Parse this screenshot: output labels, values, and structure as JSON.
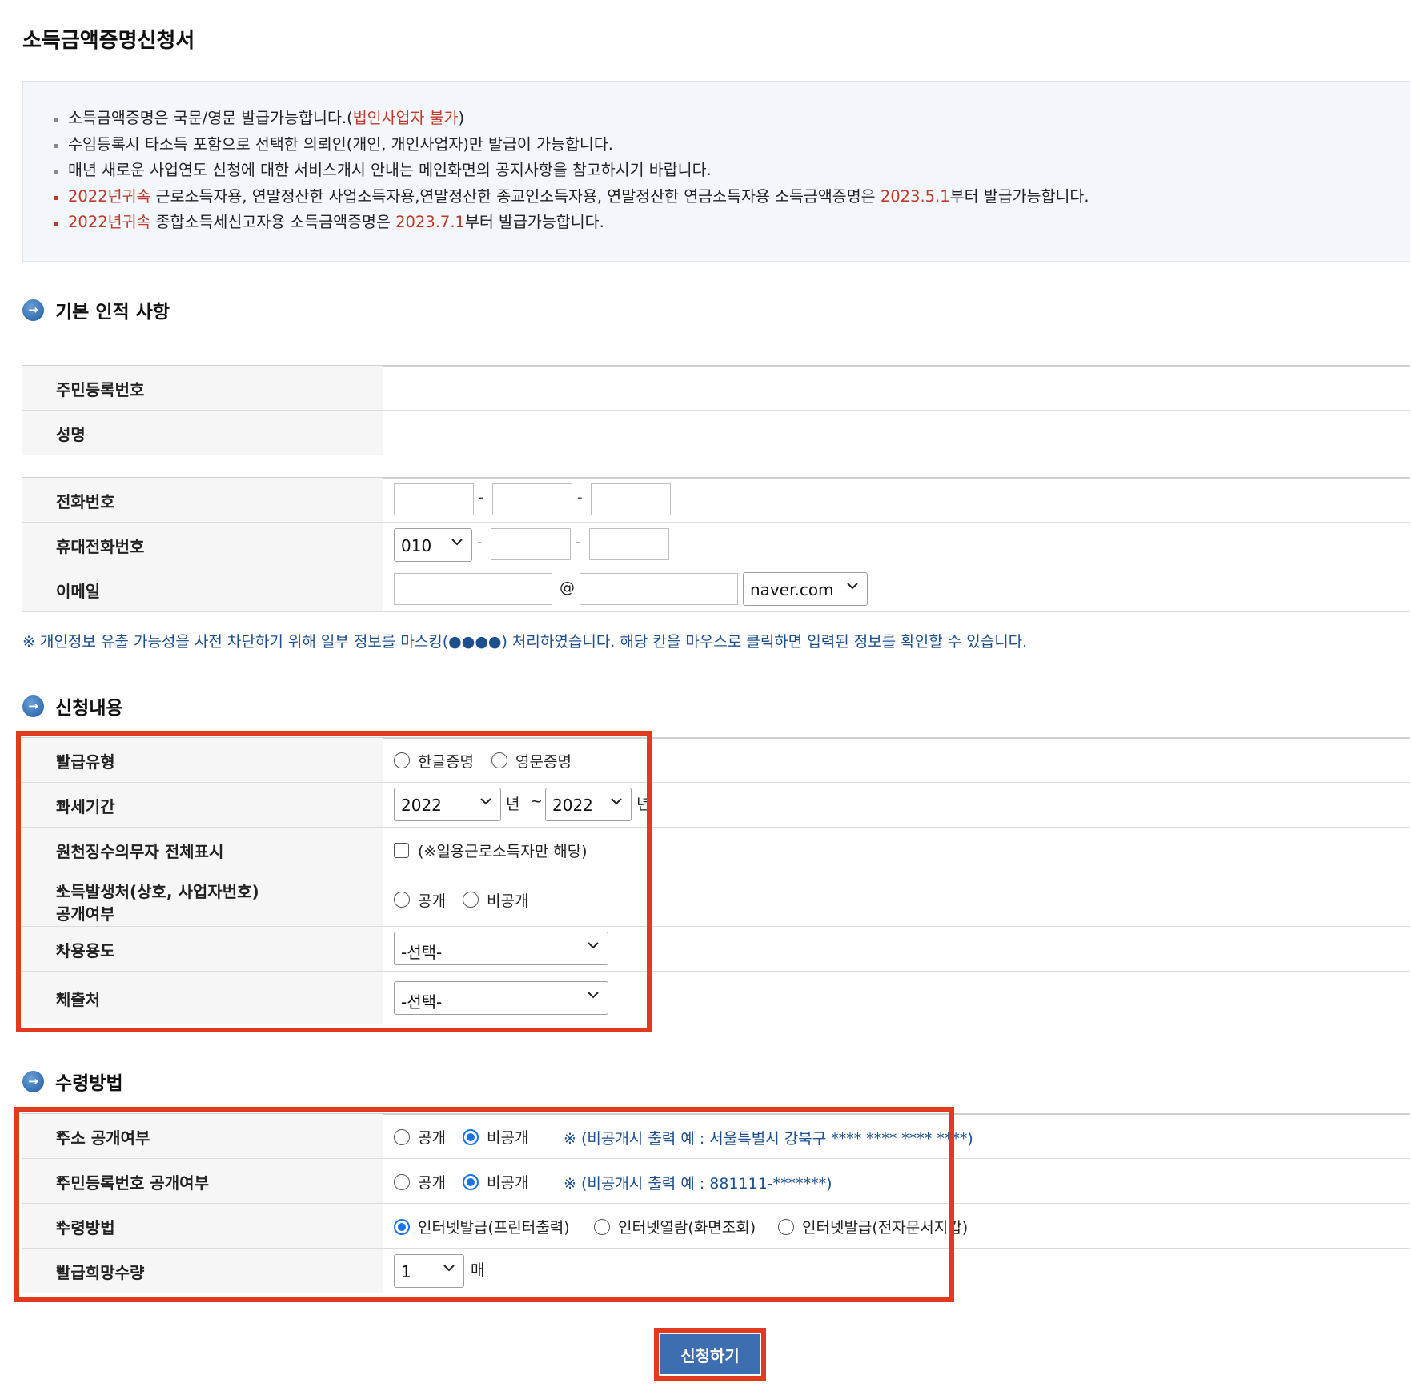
{
  "page": {
    "title": "소득금액증명신청서"
  },
  "notice": {
    "line1_a": "소득금액증명은 국문/영문 발급가능합니다.(",
    "line1_red": "법인사업자 불가",
    "line1_b": ")",
    "line2": "수임등록시 타소득 포함으로 선택한 의뢰인(개인, 개인사업자)만 발급이 가능합니다.",
    "line3": "매년 새로운 사업연도 신청에 대한 서비스개시 안내는 메인화면의 공지사항을 참고하시기 바랍니다.",
    "line4_red1": "2022년귀속",
    "line4_a": " 근로소득자용, 연말정산한 사업소득자용,연말정산한 종교인소득자용, 연말정산한 연금소득자용 소득금액증명은 ",
    "line4_red2": "2023.5.1",
    "line4_b": "부터 발급가능합니다.",
    "line5_red1": "2022년귀속",
    "line5_a": " 종합소득세신고자용 소득금액증명은 ",
    "line5_red2": "2023.7.1",
    "line5_b": "부터 발급가능합니다."
  },
  "basic": {
    "title": "기본 인적 사항",
    "resident_label": "주민등록번호",
    "name_label": "성명",
    "phone_label": "전화번호",
    "mobile_label": "휴대전화번호",
    "mobile_prefix": "010",
    "email_label": "이메일",
    "at": "@",
    "email_domain": "naver.com",
    "dash": "-",
    "mask_note": "※ 개인정보 유출 가능성을 사전 차단하기 위해 일부 정보를 마스킹(●●●●) 처리하였습니다. 해당 칸을 마우스로 클릭하면 입력된 정보를 확인할 수 있습니다."
  },
  "request": {
    "title": "신청내용",
    "req_mark": "*",
    "issue_type_label": "발급유형",
    "issue_korean": "한글증명",
    "issue_english": "영문증명",
    "period_label": "과세기간",
    "year_from": "2022",
    "year_unit": "년",
    "tilde": "~",
    "year_to": "2022",
    "withholding_label": "원천징수의무자 전체표시",
    "withholding_note": "(※일용근로소득자만 해당)",
    "source_label_1": "소득발생처(상호, 사업자번호)",
    "source_label_2": "공개여부",
    "public": "공개",
    "private": "비공개",
    "usage_label": "사용용도",
    "usage_value": "-선택-",
    "submit_to_label": "제출처",
    "submit_to_value": "-선택-"
  },
  "receive": {
    "title": "수령방법",
    "address_label": "주소 공개여부",
    "address_note": "※ (비공개시 출력 예 : 서울특별시 강북구 **** **** **** ****)",
    "rrn_label": "주민등록번호 공개여부",
    "rrn_note": "※ (비공개시 출력 예 : 881111-*******)",
    "method_label": "수령방법",
    "method_print": "인터넷발급(프린터출력)",
    "method_view": "인터넷열람(화면조회)",
    "method_wallet": "인터넷발급(전자문서지갑)",
    "copies_label": "발급희망수량",
    "copies_value": "1",
    "copies_unit": "매"
  },
  "submit_label": "신청하기",
  "colors": {
    "accent_red": "#c0392b",
    "highlight_box": "#e2391f",
    "button_blue": "#3d6fb0",
    "note_blue": "#1d4f8f"
  }
}
